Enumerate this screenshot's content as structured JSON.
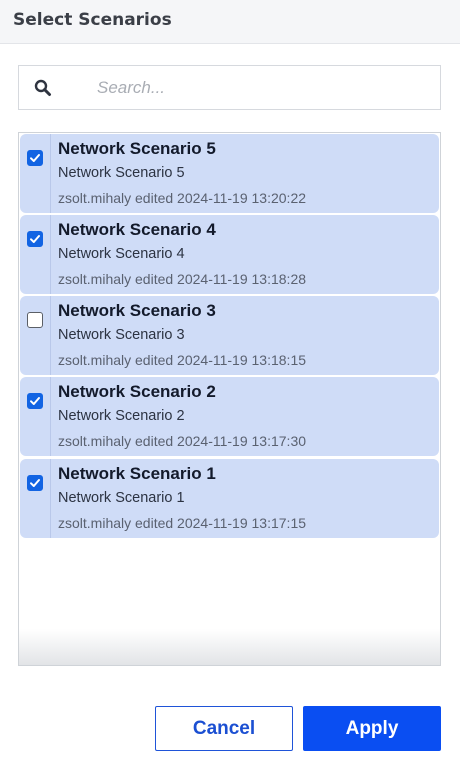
{
  "dialog": {
    "title": "Select Scenarios"
  },
  "search": {
    "placeholder": "Search...",
    "value": "",
    "icon": "search-icon"
  },
  "scenarios": [
    {
      "name": "Network Scenario 5",
      "description": "Network Scenario 5",
      "edited": "zsolt.mihaly edited 2024-11-19 13:20:22",
      "checked": true
    },
    {
      "name": "Network Scenario 4",
      "description": "Network Scenario 4",
      "edited": "zsolt.mihaly edited 2024-11-19 13:18:28",
      "checked": true
    },
    {
      "name": "Network Scenario 3",
      "description": "Network Scenario 3",
      "edited": "zsolt.mihaly edited 2024-11-19 13:18:15",
      "checked": false
    },
    {
      "name": "Network Scenario 2",
      "description": "Network Scenario 2",
      "edited": "zsolt.mihaly edited 2024-11-19 13:17:30",
      "checked": true
    },
    {
      "name": "Network Scenario 1",
      "description": "Network Scenario 1",
      "edited": "zsolt.mihaly edited 2024-11-19 13:17:15",
      "checked": true
    }
  ],
  "footer": {
    "cancel_label": "Cancel",
    "apply_label": "Apply"
  },
  "colors": {
    "accent": "#0a4ef2",
    "selected_row": "#cfdcf7",
    "checkbox": "#1264e3"
  }
}
